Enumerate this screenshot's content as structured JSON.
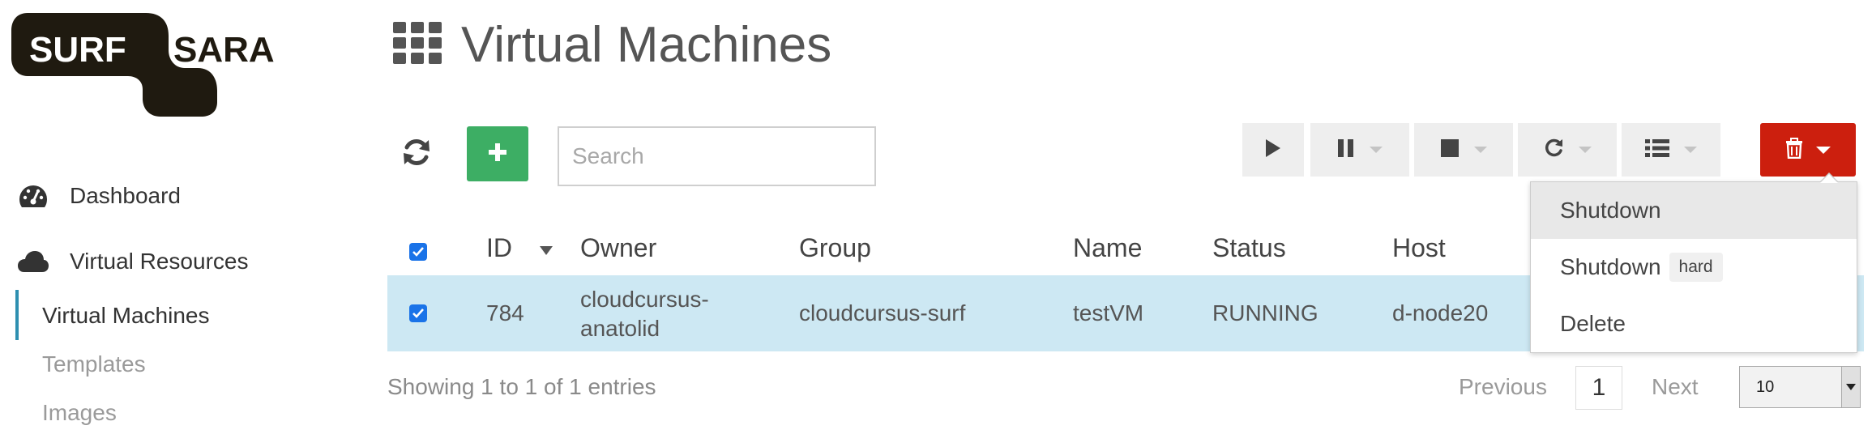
{
  "logo": {
    "left_text": "SURF",
    "right_text": "SARA"
  },
  "sidebar": {
    "items": [
      {
        "label": "Dashboard",
        "icon": "dashboard-gauge-icon"
      },
      {
        "label": "Virtual Resources",
        "icon": "cloud-icon"
      }
    ],
    "sub_items": [
      {
        "label": "Virtual Machines",
        "active": true
      },
      {
        "label": "Templates",
        "active": false
      },
      {
        "label": "Images",
        "active": false
      }
    ]
  },
  "page": {
    "title": "Virtual Machines",
    "title_icon": "grid-icon"
  },
  "toolbar": {
    "search_placeholder": "Search",
    "icons": [
      "refresh-icon",
      "plus-icon",
      "play-icon",
      "pause-icon",
      "stop-icon",
      "reboot-icon",
      "list-icon",
      "trash-icon"
    ]
  },
  "table": {
    "columns": [
      "ID",
      "Owner",
      "Group",
      "Name",
      "Status",
      "Host"
    ],
    "rows": [
      {
        "id": "784",
        "owner_line1": "cloudcursus-",
        "owner_line2": "anatolid",
        "group": "cloudcursus-surf",
        "name": "testVM",
        "status": "RUNNING",
        "host": "d-node20"
      }
    ]
  },
  "footer": {
    "info": "Showing 1 to 1 of 1 entries",
    "previous": "Previous",
    "current_page": "1",
    "next": "Next",
    "page_size": "10"
  },
  "dropdown": {
    "items": [
      {
        "label": "Shutdown",
        "badge": ""
      },
      {
        "label": "Shutdown",
        "badge": "hard"
      },
      {
        "label": "Delete",
        "badge": ""
      }
    ]
  },
  "colors": {
    "brand": "#1f1a10",
    "accent": "#2d8fb0",
    "success": "#3dae64",
    "danger": "#cc1f0e",
    "selected_row": "#cde8f3"
  }
}
